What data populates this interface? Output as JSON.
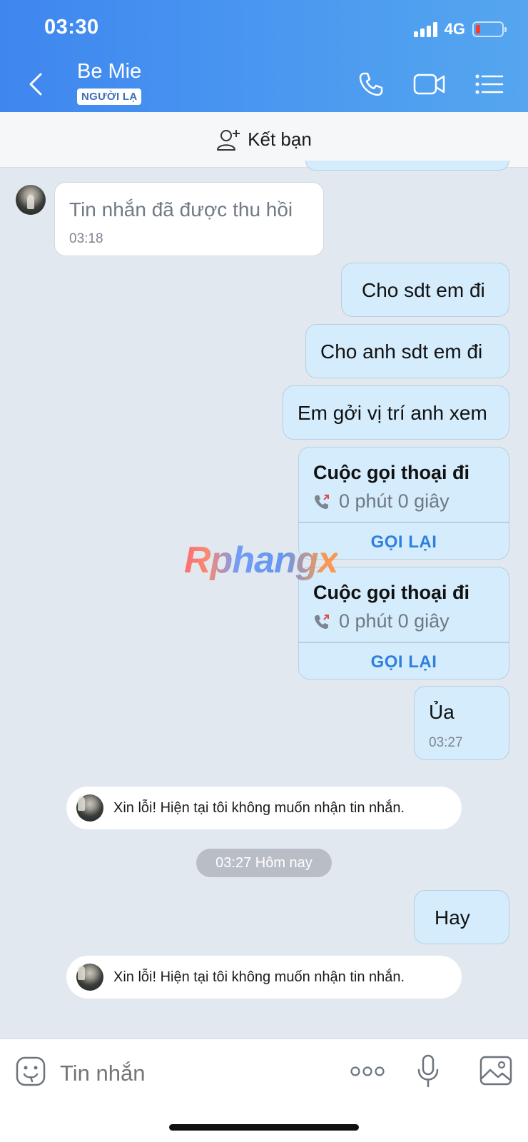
{
  "status_bar": {
    "time": "03:30",
    "network": "4G"
  },
  "header": {
    "contact_name": "Be Mie",
    "badge": "NGƯỜI LẠ",
    "icons": [
      "back-chevron-icon",
      "phone-icon",
      "video-camera-icon",
      "menu-list-icon"
    ]
  },
  "friend_bar": {
    "label": "Kết bạn",
    "icon": "add-person-icon"
  },
  "messages": {
    "recalled": {
      "text": "Tin nhắn đã được thu hồi",
      "time": "03:18"
    },
    "out1": {
      "text": "Cho sdt em đi"
    },
    "out2": {
      "text": "Cho anh sdt em đi"
    },
    "out3": {
      "text": "Em gởi vị trí anh xem"
    },
    "call1": {
      "title": "Cuộc gọi thoại đi",
      "duration": "0 phút 0 giây",
      "action": "GỌI LẠI"
    },
    "call2": {
      "title": "Cuộc gọi thoại đi",
      "duration": "0 phút 0 giây",
      "action": "GỌI LẠI"
    },
    "out4": {
      "text": "Ủa",
      "time": "03:27"
    },
    "system1": {
      "text": "Xin lỗi! Hiện tại tôi không muốn nhận tin nhắn."
    },
    "date_separator": "03:27 Hôm nay",
    "out5": {
      "text": "Hay"
    },
    "system2": {
      "text": "Xin lỗi! Hiện tại tôi không muốn nhận tin nhắn."
    }
  },
  "watermark": "Rphangx",
  "composer": {
    "placeholder": "Tin nhắn",
    "icons": [
      "sticker-icon",
      "more-dots-icon",
      "microphone-icon",
      "image-icon"
    ]
  },
  "colors": {
    "header_start": "#3f86ef",
    "header_end": "#55a6ef",
    "outgoing_bubble": "#d4ecfb",
    "link_blue": "#2f7fe0"
  }
}
